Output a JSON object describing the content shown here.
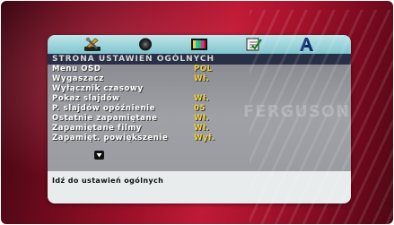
{
  "tabs": [
    {
      "icon": "tools-icon"
    },
    {
      "icon": "speaker-icon"
    },
    {
      "icon": "color-bars-icon"
    },
    {
      "icon": "checklist-icon"
    },
    {
      "icon": "text-a-icon"
    }
  ],
  "menu": {
    "title": "STRONA USTAWIEŃ OGÓLNYCH",
    "items": [
      {
        "label": "Menu OSD",
        "value": "POL"
      },
      {
        "label": "Wygaszacz",
        "value": "Wł."
      },
      {
        "label": "Wyłącznik czasowy",
        "value": ""
      },
      {
        "label": "Pokaz slajdów",
        "value": "Wł."
      },
      {
        "label": "P. slajdów opóźnienie",
        "value": "05"
      },
      {
        "label": "Ostatnie zapamiętane",
        "value": "Wł."
      },
      {
        "label": "Zapamiętane filmy",
        "value": "Wł."
      },
      {
        "label": "Zapamięt. powiększenie",
        "value": "Wył."
      }
    ],
    "more_icon": "arrow-down-icon",
    "help_text": "Idź do ustawień ogólnych"
  },
  "watermark": "FERGUSON",
  "colors": {
    "value_text": "#f4d23c",
    "title_bar": "#2a2f48",
    "icon_bar": "#9fd6dc"
  }
}
